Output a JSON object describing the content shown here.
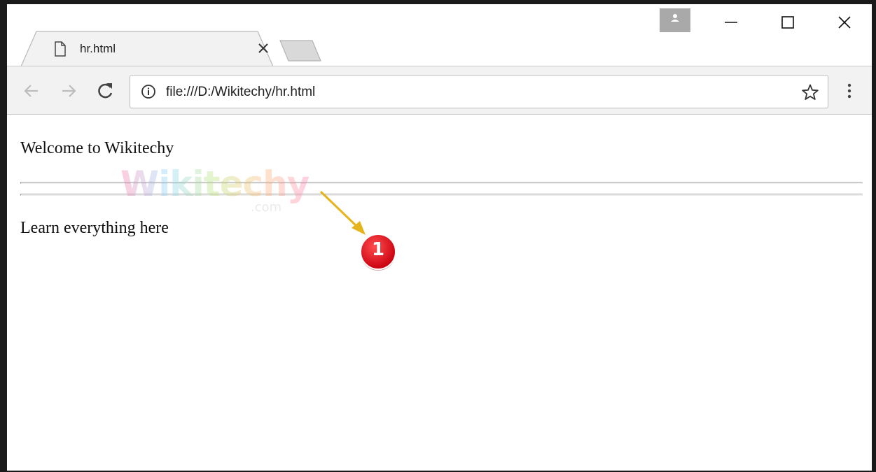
{
  "tab": {
    "title": "hr.html"
  },
  "address_bar": {
    "url": "file:///D:/Wikitechy/hr.html"
  },
  "page": {
    "paragraph_1": "Welcome to Wikitechy",
    "paragraph_2": "Learn everything here"
  },
  "watermark": {
    "text": "Wikitechy",
    "sub": ".com"
  },
  "annotation": {
    "badge_number": "1",
    "badge_color": "#e30613",
    "arrow_color": "#e5b41c"
  },
  "icons": {
    "tab": "document-icon",
    "tab_close": "close-icon",
    "profile": "person-icon",
    "minimize": "minimize-icon",
    "maximize": "maximize-icon",
    "window_close": "close-icon",
    "back": "arrow-left-icon",
    "forward": "arrow-right-icon",
    "reload": "reload-icon",
    "info": "info-icon",
    "bookmark": "star-icon",
    "menu": "kebab-menu-icon"
  }
}
